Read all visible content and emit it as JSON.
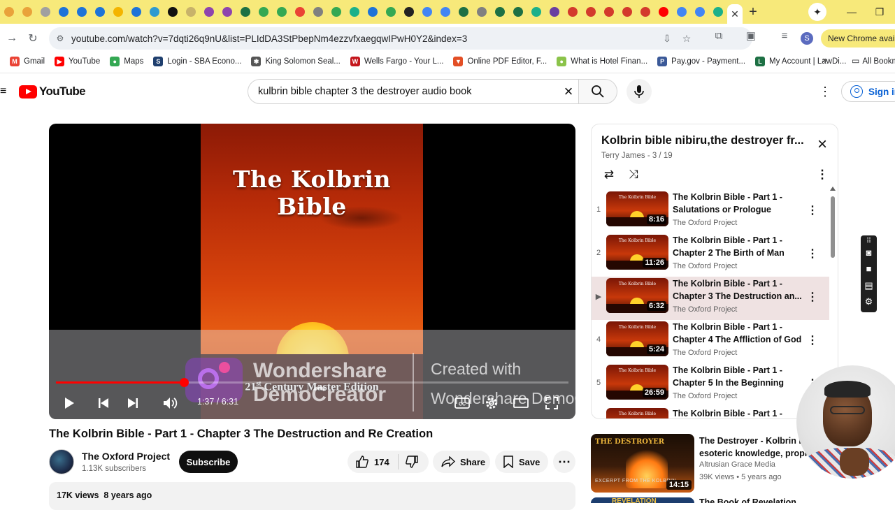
{
  "tabs": {
    "favicons": [
      {
        "name": "tab-favicon-1",
        "color": "#e9a23b"
      },
      {
        "name": "tab-favicon-2",
        "color": "#e9a23b"
      },
      {
        "name": "tab-favicon-3",
        "color": "#a0a0a0"
      },
      {
        "name": "tab-favicon-4",
        "color": "#1e73d8"
      },
      {
        "name": "tab-favicon-5",
        "color": "#1e73d8"
      },
      {
        "name": "tab-favicon-6",
        "color": "#1e73d8"
      },
      {
        "name": "tab-favicon-7",
        "color": "#f4b400"
      },
      {
        "name": "tab-favicon-8",
        "color": "#1e73d8"
      },
      {
        "name": "tab-favicon-9",
        "color": "#2e9ad0"
      },
      {
        "name": "tab-favicon-10",
        "color": "#111111"
      },
      {
        "name": "tab-favicon-11",
        "color": "#c8b26a"
      },
      {
        "name": "tab-favicon-12",
        "color": "#8e44ad"
      },
      {
        "name": "tab-favicon-13",
        "color": "#8e44ad"
      },
      {
        "name": "tab-favicon-14",
        "color": "#1d7044"
      },
      {
        "name": "tab-favicon-15",
        "color": "#34a853"
      },
      {
        "name": "tab-favicon-16",
        "color": "#34a853"
      },
      {
        "name": "tab-favicon-17",
        "color": "#ea4335"
      },
      {
        "name": "tab-favicon-18",
        "color": "#808080"
      },
      {
        "name": "tab-favicon-19",
        "color": "#34a853"
      },
      {
        "name": "tab-favicon-20",
        "color": "#1bb08a"
      },
      {
        "name": "tab-favicon-21",
        "color": "#1e73d8"
      },
      {
        "name": "tab-favicon-22",
        "color": "#34a853"
      },
      {
        "name": "tab-favicon-23",
        "color": "#222222"
      },
      {
        "name": "tab-favicon-24",
        "color": "#4285f4"
      },
      {
        "name": "tab-favicon-25",
        "color": "#4285f4"
      },
      {
        "name": "tab-favicon-26",
        "color": "#1d7044"
      },
      {
        "name": "tab-favicon-27",
        "color": "#808080"
      },
      {
        "name": "tab-favicon-28",
        "color": "#1d7044"
      },
      {
        "name": "tab-favicon-29",
        "color": "#1d7044"
      },
      {
        "name": "tab-favicon-30",
        "color": "#1bb08a"
      },
      {
        "name": "tab-favicon-31",
        "color": "#6a3fa0"
      },
      {
        "name": "tab-favicon-32",
        "color": "#d33a2c"
      },
      {
        "name": "tab-favicon-33",
        "color": "#d33a2c"
      },
      {
        "name": "tab-favicon-34",
        "color": "#d33a2c"
      },
      {
        "name": "tab-favicon-35",
        "color": "#d33a2c"
      },
      {
        "name": "tab-favicon-36",
        "color": "#d33a2c"
      },
      {
        "name": "tab-favicon-37",
        "color": "#ff0000"
      },
      {
        "name": "tab-favicon-38",
        "color": "#4285f4"
      },
      {
        "name": "tab-favicon-39",
        "color": "#4285f4"
      },
      {
        "name": "tab-favicon-40",
        "color": "#1bb08a"
      }
    ],
    "active_close": "✕",
    "new_tab": "+"
  },
  "window": {
    "minimize": "—",
    "restore": "❐"
  },
  "toolbar": {
    "url": "youtube.com/watch?v=7dqti26q9nU&list=PLIdDA3StPbepNm4ezzvfxaegqwIPwH0Y2&index=3",
    "profile_letter": "S",
    "new_chrome": "New Chrome available"
  },
  "bookmarks": {
    "items": [
      {
        "label": "Gmail",
        "color": "#ea4335",
        "glyph": "M"
      },
      {
        "label": "YouTube",
        "color": "#ff0000",
        "glyph": "▶"
      },
      {
        "label": "Maps",
        "color": "#34a853",
        "glyph": "●"
      },
      {
        "label": "Login - SBA Econo...",
        "color": "#1f3f6e",
        "glyph": "S"
      },
      {
        "label": "King Solomon Seal...",
        "color": "#555555",
        "glyph": "✱"
      },
      {
        "label": "Wells Fargo - Your L...",
        "color": "#c4161c",
        "glyph": "W"
      },
      {
        "label": "Online PDF Editor, F...",
        "color": "#e34f26",
        "glyph": "▼"
      },
      {
        "label": "What is Hotel Finan...",
        "color": "#8bc34a",
        "glyph": "●"
      },
      {
        "label": "Pay.gov - Payment...",
        "color": "#3b5998",
        "glyph": "P"
      },
      {
        "label": "My Account | LawDi...",
        "color": "#1d7044",
        "glyph": "L"
      }
    ],
    "more": "»",
    "all": "All Bookmarks"
  },
  "youtube": {
    "logo_text": "YouTube",
    "search_value": "kulbrin bible chapter 3 the destroyer audio book",
    "signin": "Sign in"
  },
  "player": {
    "frame_title": "The Kolbrin Bible",
    "frame_edition_prefix": "21",
    "frame_edition_sup": "st",
    "frame_edition_suffix": " Century Master Edition",
    "watermark_name_1": "Wondershare",
    "watermark_name_2": "DemoCreator",
    "watermark_created_1": "Created with",
    "watermark_created_2": "Wondershare DemoCreator free pl...",
    "time": "1:37 / 6:31",
    "progress_fraction": 0.25
  },
  "video": {
    "title": "The Kolbrin Bible - Part 1 - Chapter 3 The Destruction and Re Creation",
    "channel": "The Oxford Project",
    "subscribers": "1.13K subscribers",
    "subscribe_label": "Subscribe",
    "likes": "174",
    "share_label": "Share",
    "save_label": "Save",
    "views": "17K views",
    "age": "8 years ago"
  },
  "playlist": {
    "title": "Kolbrin bible nibiru,the destroyer fr...",
    "meta": "Terry James - 3 / 19",
    "items": [
      {
        "index": "1",
        "title": "The Kolbrin Bible - Part 1 - Salutations or Prologue",
        "channel": "The Oxford Project",
        "duration": "8:16",
        "active": false
      },
      {
        "index": "2",
        "title": "The Kolbrin Bible - Part 1 - Chapter 2 The Birth of Man",
        "channel": "The Oxford Project",
        "duration": "11:26",
        "active": false
      },
      {
        "index": "▶",
        "title": "The Kolbrin Bible - Part 1 - Chapter 3 The Destruction an...",
        "channel": "The Oxford Project",
        "duration": "6:32",
        "active": true
      },
      {
        "index": "4",
        "title": "The Kolbrin Bible - Part 1 - Chapter 4 The Affliction of God",
        "channel": "The Oxford Project",
        "duration": "5:24",
        "active": false
      },
      {
        "index": "5",
        "title": "The Kolbrin Bible - Part 1 - Chapter 5 In the Beginning",
        "channel": "The Oxford Project",
        "duration": "26:59",
        "active": false
      },
      {
        "index": "",
        "title": "The Kolbrin Bible - Part 1 -",
        "channel": "",
        "duration": "",
        "active": false
      }
    ]
  },
  "recommended": [
    {
      "thumb_tag": "THE DESTROYER",
      "thumb_sub": "EXCERPT FROM THE KOLBRIN",
      "duration": "14:15",
      "title_line1": "The Destroyer - Kolbrin Bible",
      "title_line2": "esoteric knowledge, prophecy",
      "channel": "Altrusian Grace Media",
      "stats": "39K views • 5 years ago"
    },
    {
      "thumb_tag": "REVELATION",
      "title_line1": "The Book of Revelation"
    }
  ]
}
